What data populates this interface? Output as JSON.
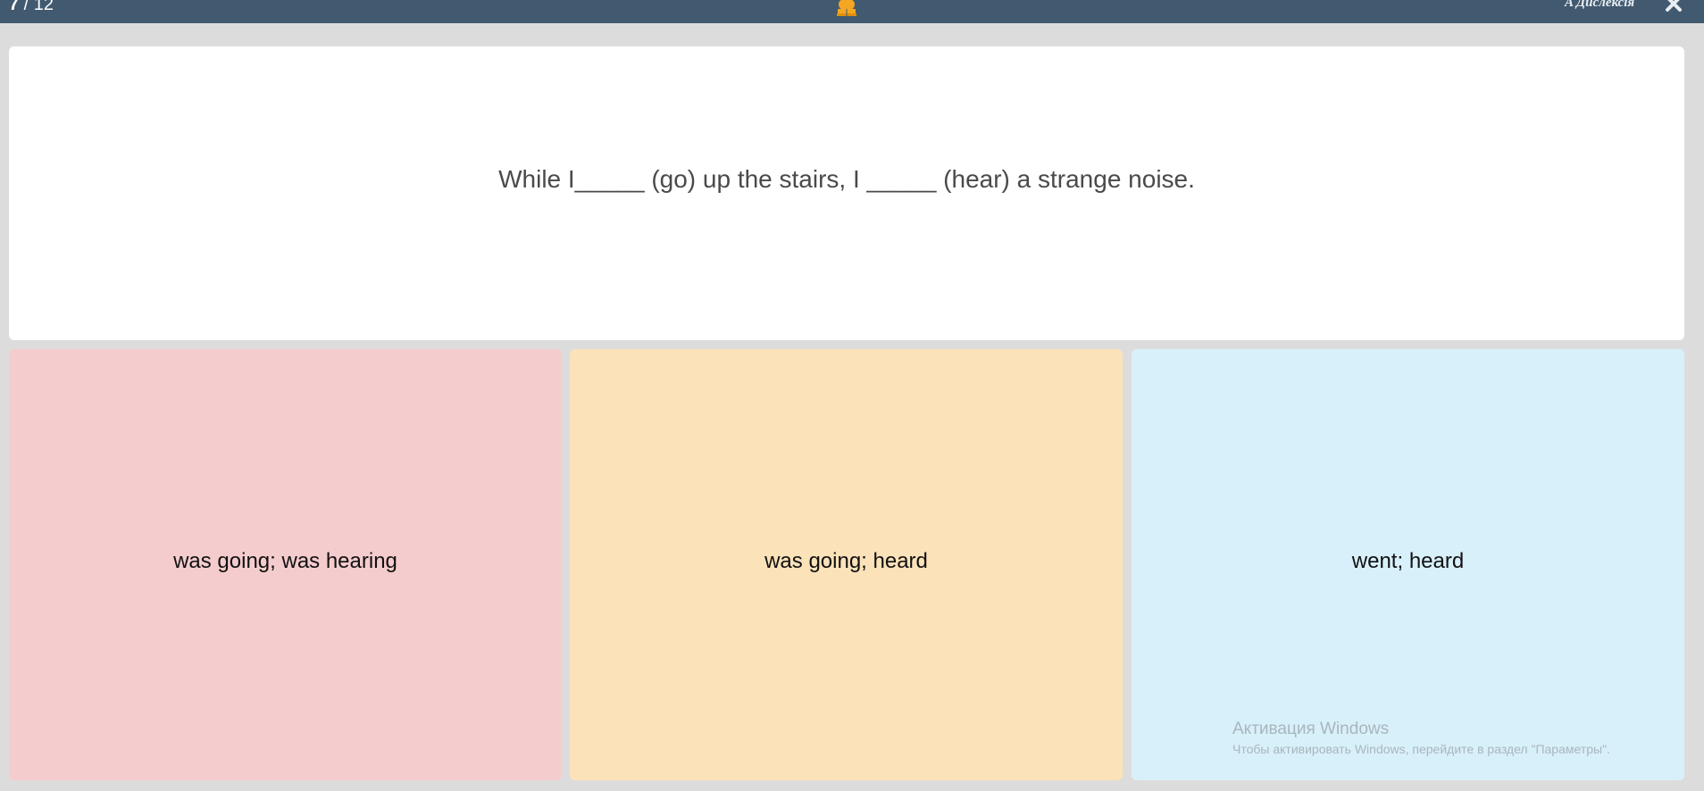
{
  "header": {
    "progress_current": "7",
    "progress_total": " / 12",
    "dyslexia_label": "A Дислексія",
    "mascot_icon": "owl-icon",
    "close_icon": "close-icon"
  },
  "question": {
    "text": "While I_____ (go) up the stairs, I _____ (hear) a strange noise."
  },
  "answers": [
    {
      "label": "was going; was hearing",
      "color": "#f5cccd"
    },
    {
      "label": "was going; heard",
      "color": "#fbe2b9"
    },
    {
      "label": "went; heard",
      "color": "#d8f0fa"
    }
  ],
  "watermark": {
    "title": "Активация Windows",
    "subtitle": "Чтобы активировать Windows, перейдите в раздел \"Параметры\"."
  },
  "colors": {
    "topbar": "#425a70",
    "background": "#dcdcdc",
    "mascot": "#f5a623"
  }
}
